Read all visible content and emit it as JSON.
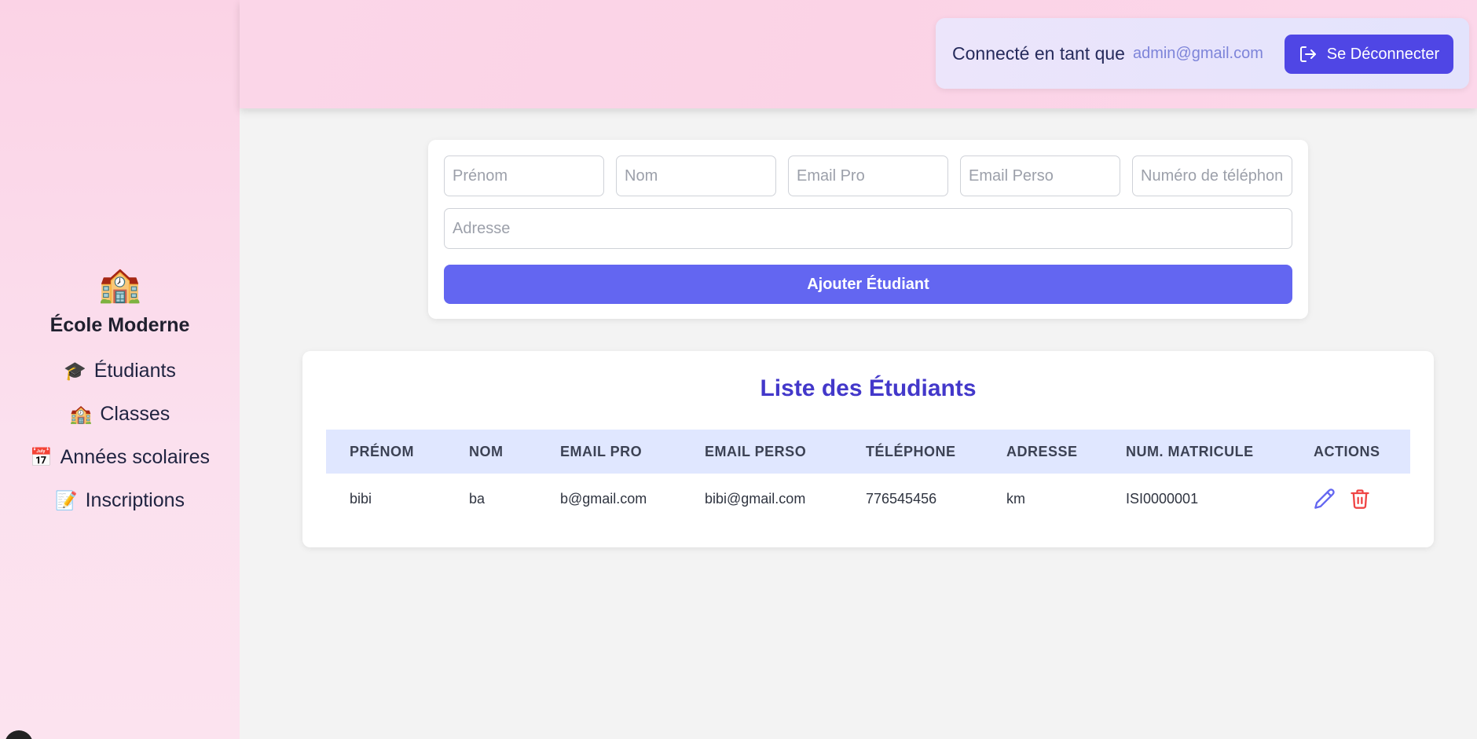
{
  "sidebar": {
    "logo_emoji": "🏫",
    "brand": "École Moderne",
    "items": [
      {
        "emoji": "🎓",
        "label": "Étudiants"
      },
      {
        "emoji": "🏫",
        "label": "Classes"
      },
      {
        "emoji": "📅",
        "label": "Années scolaires"
      },
      {
        "emoji": "📝",
        "label": "Inscriptions"
      }
    ]
  },
  "header": {
    "connected_label": "Connecté en tant que",
    "user_email": "admin@gmail.com",
    "logout_label": "Se Déconnecter"
  },
  "form": {
    "placeholders": {
      "prenom": "Prénom",
      "nom": "Nom",
      "email_pro": "Email Pro",
      "email_perso": "Email Perso",
      "telephone": "Numéro de téléphone",
      "adresse": "Adresse"
    },
    "submit_label": "Ajouter Étudiant"
  },
  "table": {
    "title": "Liste des Étudiants",
    "columns": [
      "PRÉNOM",
      "NOM",
      "EMAIL PRO",
      "EMAIL PERSO",
      "TÉLÉPHONE",
      "ADRESSE",
      "NUM. MATRICULE",
      "ACTIONS"
    ],
    "rows": [
      {
        "prenom": "bibi",
        "nom": "ba",
        "email_pro": "b@gmail.com",
        "email_perso": "bibi@gmail.com",
        "telephone": "776545456",
        "adresse": "km",
        "matricule": "ISI0000001"
      }
    ]
  },
  "colors": {
    "accent": "#4f46e5",
    "button": "#6366f1",
    "title": "#4338ca",
    "edit_icon": "#6366f1",
    "delete_icon": "#ef4444"
  }
}
